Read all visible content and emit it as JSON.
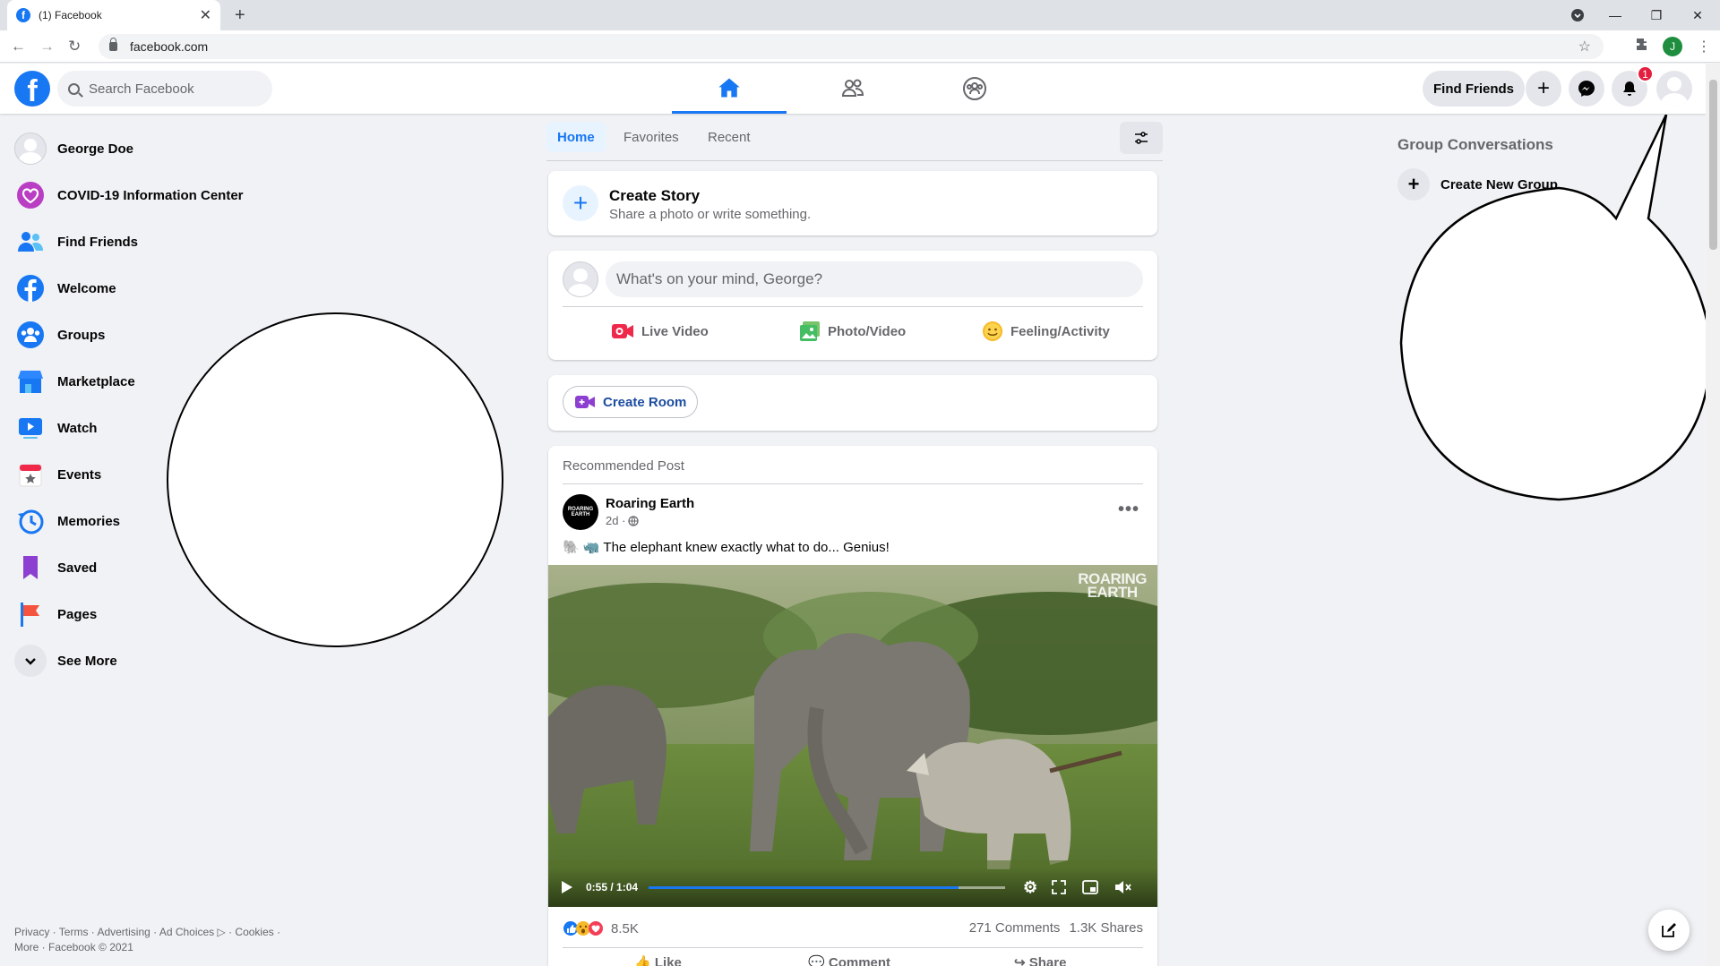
{
  "browser": {
    "tab_title": "(1) Facebook",
    "favicon_letter": "f",
    "url": "facebook.com",
    "profile_initial": "J"
  },
  "header": {
    "logo_letter": "f",
    "search_placeholder": "Search Facebook",
    "find_friends_label": "Find Friends",
    "notification_count": "1",
    "active_tab": "home"
  },
  "sidebar": {
    "items": [
      {
        "label": "George Doe",
        "icon": "profile-avatar"
      },
      {
        "label": "COVID-19 Information Center",
        "icon": "covid-heart-icon"
      },
      {
        "label": "Find Friends",
        "icon": "friends-icon"
      },
      {
        "label": "Welcome",
        "icon": "facebook-icon"
      },
      {
        "label": "Groups",
        "icon": "groups-icon"
      },
      {
        "label": "Marketplace",
        "icon": "marketplace-icon"
      },
      {
        "label": "Watch",
        "icon": "watch-icon"
      },
      {
        "label": "Events",
        "icon": "events-icon"
      },
      {
        "label": "Memories",
        "icon": "memories-icon"
      },
      {
        "label": "Saved",
        "icon": "saved-icon"
      },
      {
        "label": "Pages",
        "icon": "pages-icon"
      },
      {
        "label": "See More",
        "icon": "chevron-down-icon"
      }
    ]
  },
  "footer": {
    "line1": "Privacy · Terms · Advertising · Ad Choices ▷ · Cookies ·",
    "line2": "More · Facebook © 2021"
  },
  "feed_tabs": {
    "home": "Home",
    "favorites": "Favorites",
    "recent": "Recent"
  },
  "story": {
    "title": "Create Story",
    "subtitle": "Share a photo or write something."
  },
  "composer": {
    "placeholder": "What's on your mind, George?",
    "live_video": "Live Video",
    "photo_video": "Photo/Video",
    "feeling": "Feeling/Activity"
  },
  "room": {
    "label": "Create Room"
  },
  "post": {
    "section_label": "Recommended Post",
    "author": "Roaring Earth",
    "author_logo_text": "ROARING EARTH",
    "time": "2d ·",
    "text": "🐘 🦏 The elephant knew exactly what to do... Genius!",
    "watermark_line1": "ROARING",
    "watermark_line2": "EARTH",
    "video_time": "0:55 / 1:04",
    "progress_fraction": 0.87,
    "reaction_count": "8.5K",
    "comments": "271 Comments",
    "shares": "1.3K Shares",
    "like": "Like",
    "comment": "Comment",
    "share": "Share"
  },
  "right_panel": {
    "heading": "Group Conversations",
    "create_group": "Create New Group"
  },
  "colors": {
    "brand": "#1877f2",
    "badge": "#e41e3f",
    "background": "#f0f2f5"
  }
}
